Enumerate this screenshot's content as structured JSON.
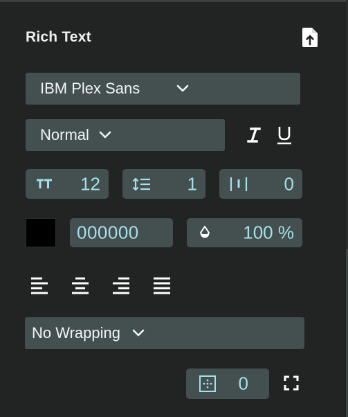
{
  "panel": {
    "title": "Rich Text",
    "export_icon": "file-export-icon"
  },
  "font_family": {
    "value": "IBM Plex Sans",
    "icon": "chevron-down-icon"
  },
  "font_style": {
    "value": "Normal",
    "icon": "chevron-down-icon"
  },
  "text_decoration": {
    "italic_icon": "italic-icon",
    "underline_icon": "underline-icon"
  },
  "metrics": {
    "font_size": {
      "icon": "font-size-icon",
      "value": "12"
    },
    "line_height": {
      "icon": "line-height-icon",
      "value": "1"
    },
    "letter_spacing": {
      "icon": "letter-spacing-icon",
      "value": "0"
    }
  },
  "color": {
    "swatch": "#000000",
    "hex": "000000",
    "opacity_icon": "opacity-drop-icon",
    "opacity": "100 %"
  },
  "alignment": {
    "options": [
      "align-left-icon",
      "align-center-icon",
      "align-right-icon",
      "align-justify-icon"
    ]
  },
  "wrapping": {
    "value": "No Wrapping",
    "icon": "chevron-down-icon"
  },
  "padding": {
    "icon": "padding-icon",
    "value": "0",
    "expand_icon": "expand-icon"
  },
  "colors": {
    "background": "#222424",
    "field": "#445050",
    "value_text": "#a6e0ea",
    "label_text": "#f2f4f4"
  }
}
